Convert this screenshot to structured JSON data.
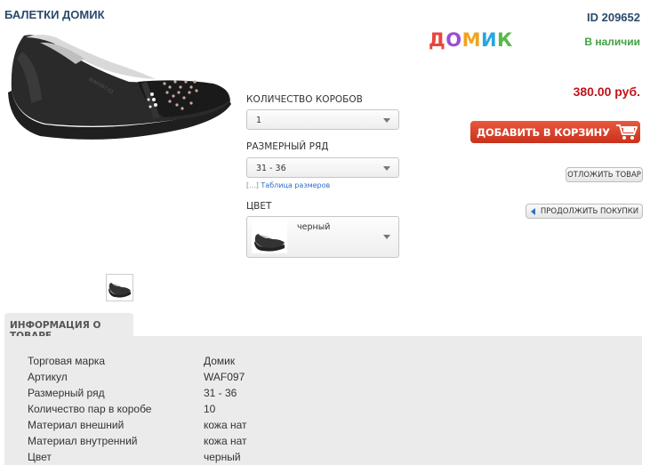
{
  "product": {
    "title": "БАЛЕТКИ ДОМИК",
    "id_label": "ID 209652",
    "brand_logo_letters": [
      "Д",
      "О",
      "М",
      "И",
      "К"
    ],
    "brand_logo_colors": [
      "#e8453c",
      "#9b4fd1",
      "#f0a41c",
      "#2aa6de",
      "#58b84a"
    ],
    "stock": "В наличии",
    "price": "380.00 руб."
  },
  "buttons": {
    "add_to_cart": "ДОБАВИТЬ В КОРЗИНУ",
    "defer": "ОТЛОЖИТЬ ТОВАР",
    "continue": "ПРОДОЛЖИТЬ ПОКУПКИ"
  },
  "options": {
    "boxes_label": "КОЛИЧЕСТВО КОРОБОВ",
    "boxes_value": "1",
    "size_label": "РАЗМЕРНЫЙ РЯД",
    "size_value": "31 - 36",
    "size_table_bracket": "[...]",
    "size_table_link": "Таблица размеров",
    "color_label": "ЦВЕТ",
    "color_value": "черный"
  },
  "info": {
    "tab": "ИНФОРМАЦИЯ О ТОВАРЕ",
    "rows": [
      {
        "k": "Торговая марка",
        "v": "Домик"
      },
      {
        "k": "Артикул",
        "v": "WAF097"
      },
      {
        "k": "Размерный ряд",
        "v": "31 - 36"
      },
      {
        "k": "Количество пар в коробе",
        "v": "10"
      },
      {
        "k": "Материал внешний",
        "v": "кожа нат"
      },
      {
        "k": "Материал внутренний",
        "v": "кожа нат"
      },
      {
        "k": "Цвет",
        "v": "черный"
      }
    ]
  },
  "icons": {
    "cart": "cart-icon",
    "caret": "chevron-down-icon",
    "back": "arrow-left-icon"
  },
  "colors": {
    "accent_red": "#c0141c",
    "stock_green": "#3fa33f",
    "link_blue": "#2a6fc9",
    "title_blue": "#2a4a6b"
  }
}
